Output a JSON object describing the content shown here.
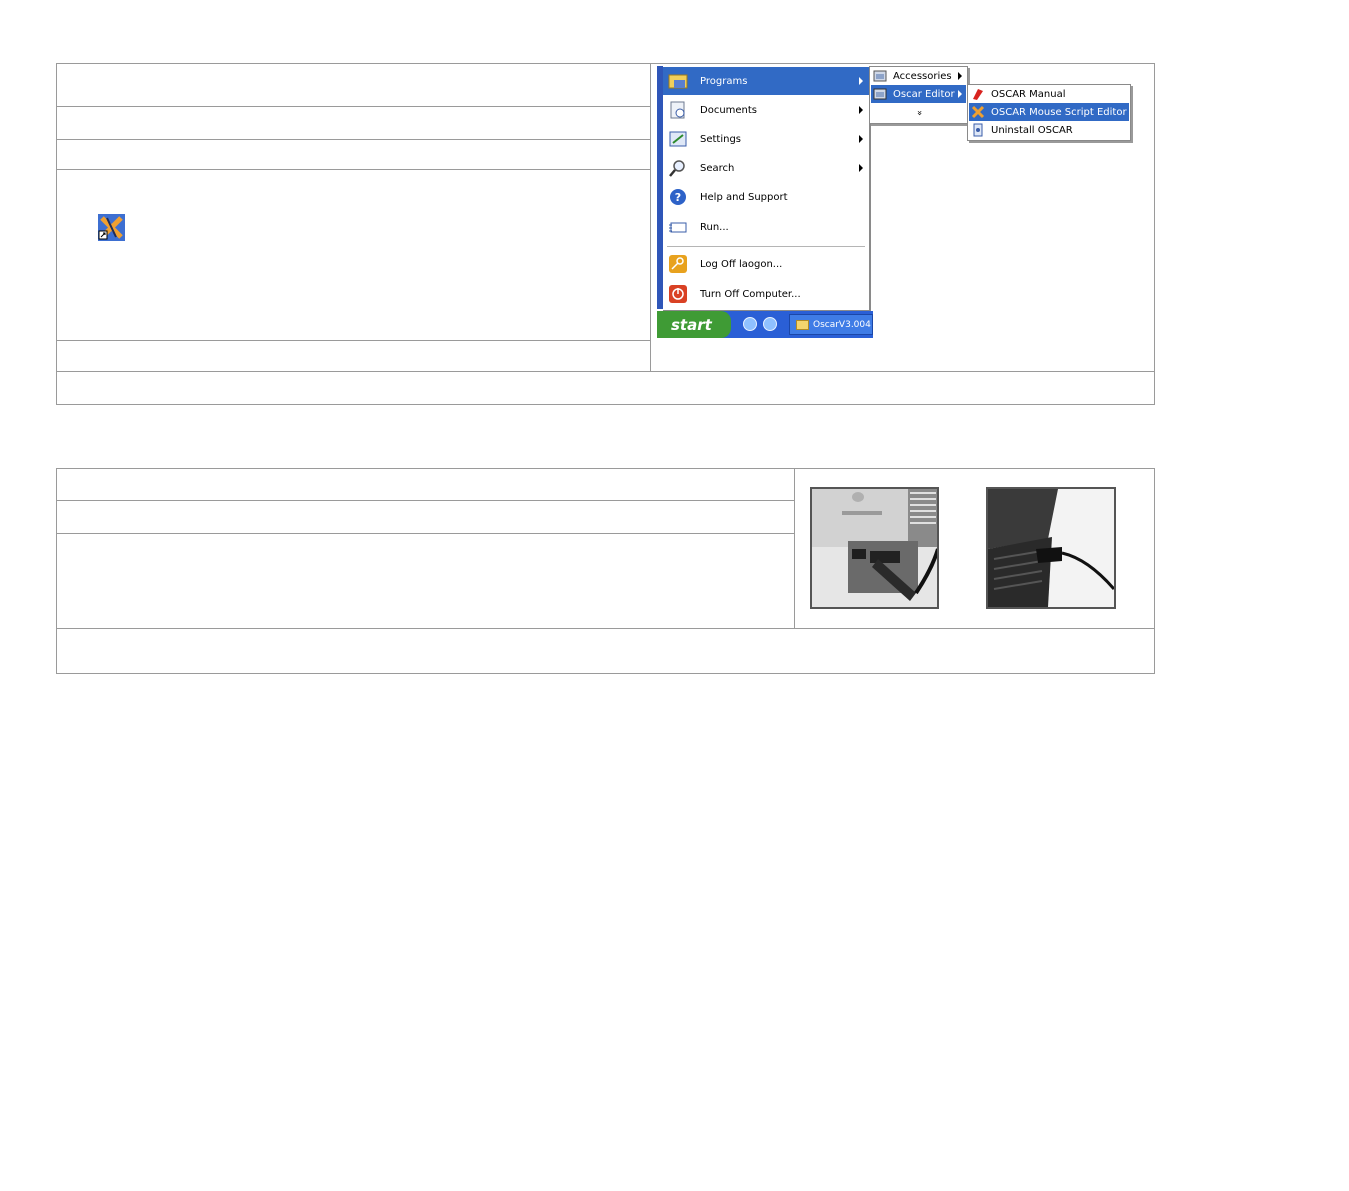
{
  "start_menu": {
    "items": [
      {
        "label": "Programs",
        "icon": "programs-icon",
        "submenu": true
      },
      {
        "label": "Documents",
        "icon": "documents-icon",
        "submenu": true
      },
      {
        "label": "Settings",
        "icon": "settings-icon",
        "submenu": true
      },
      {
        "label": "Search",
        "icon": "search-icon",
        "submenu": true
      },
      {
        "label": "Help and Support",
        "icon": "help-icon",
        "submenu": false
      },
      {
        "label": "Run...",
        "icon": "run-icon",
        "submenu": false
      },
      {
        "label": "Log Off laogon...",
        "icon": "logoff-icon",
        "submenu": false
      },
      {
        "label": "Turn Off Computer...",
        "icon": "power-icon",
        "submenu": false
      }
    ],
    "programs_submenu": [
      {
        "label": "Accessories"
      },
      {
        "label": "Oscar Editor"
      },
      {
        "label": "»"
      }
    ],
    "oscar_submenu": [
      {
        "label": "OSCAR Manual",
        "icon": "manual-icon"
      },
      {
        "label": "OSCAR Mouse Script Editor",
        "icon": "oscar-icon"
      },
      {
        "label": "Uninstall OSCAR",
        "icon": "uninstall-icon"
      }
    ],
    "taskbar": {
      "start_label": "start",
      "task_label": "OscarV3.004"
    }
  },
  "photos": [
    {
      "alt": "usb-plug-desktop-photo"
    },
    {
      "alt": "usb-plug-laptop-photo"
    }
  ],
  "colors": {
    "highlight": "#316ac5",
    "taskbar": "#2a5fd6",
    "start_button": "#3f9b35",
    "border": "#9a9a9a"
  }
}
